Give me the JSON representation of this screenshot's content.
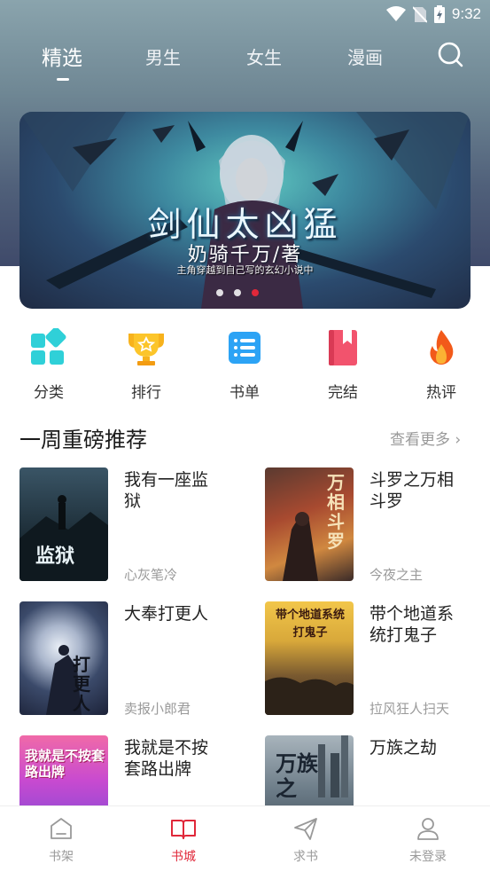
{
  "status_bar": {
    "time": "9:32"
  },
  "top_tabs": [
    {
      "label": "精选",
      "active": true
    },
    {
      "label": "男生",
      "active": false
    },
    {
      "label": "女生",
      "active": false
    },
    {
      "label": "漫画",
      "active": false
    }
  ],
  "banner": {
    "title": "剑仙太凶猛",
    "author": "奶骑千万/著",
    "tagline": "主角穿越到自己写的玄幻小说中",
    "slide_count": 3,
    "active_slide": 3
  },
  "quicknav": [
    {
      "label": "分类",
      "icon": "category-icon"
    },
    {
      "label": "排行",
      "icon": "trophy-icon"
    },
    {
      "label": "书单",
      "icon": "booklist-icon"
    },
    {
      "label": "完结",
      "icon": "bookmark-book-icon"
    },
    {
      "label": "热评",
      "icon": "flame-icon"
    }
  ],
  "section": {
    "title": "一周重磅推荐",
    "more": "查看更多 ›"
  },
  "books": [
    {
      "title": "我有一座监狱",
      "author": "心灰笔冷",
      "cover_text": "监狱"
    },
    {
      "title": "斗罗之万相斗罗",
      "author": "今夜之主",
      "cover_text": "万相斗罗"
    },
    {
      "title": "大奉打更人",
      "author": "卖报小郎君",
      "cover_text": "打更人"
    },
    {
      "title": "带个地道系统打鬼子",
      "author": "拉风狂人扫天",
      "cover_text": "带个地道系统 打鬼子"
    },
    {
      "title": "我就是不按套路出牌",
      "author": "",
      "cover_text": "我就是不按套路出牌"
    },
    {
      "title": "万族之劫",
      "author": "",
      "cover_text": "万族之"
    }
  ],
  "bottom_nav": [
    {
      "label": "书架",
      "active": false
    },
    {
      "label": "书城",
      "active": true
    },
    {
      "label": "求书",
      "active": false
    },
    {
      "label": "未登录",
      "active": false
    }
  ],
  "colors": {
    "accent": "#e0283a",
    "muted": "#999999"
  }
}
